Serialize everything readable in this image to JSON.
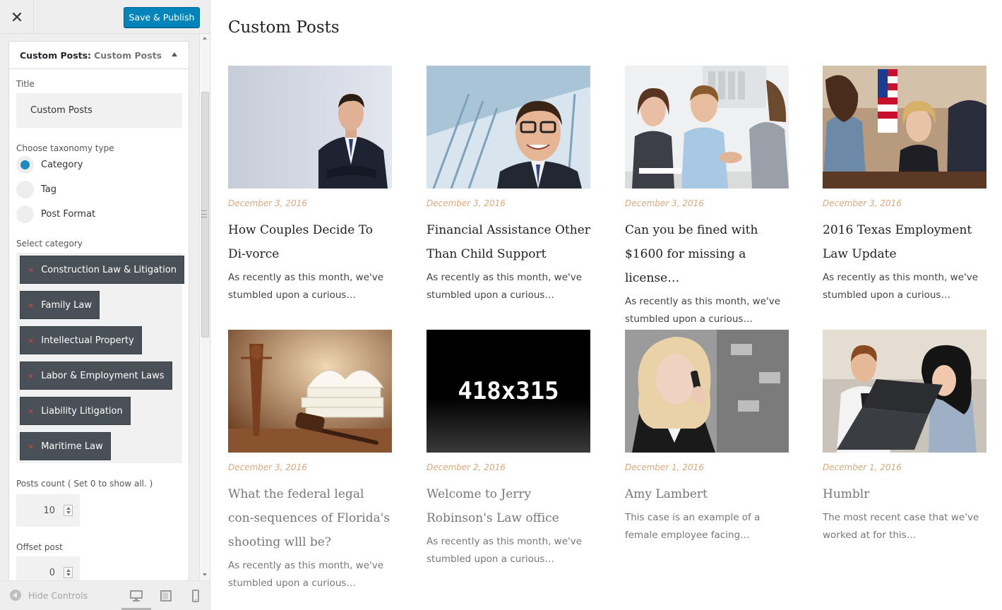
{
  "sidebar": {
    "save_label": "Save & Publish",
    "section_label": "Custom Posts:",
    "section_sub": "Custom Posts",
    "title_label": "Title",
    "title_value": "Custom Posts",
    "taxonomy_label": "Choose taxonomy type",
    "taxonomy_options": [
      "Category",
      "Tag",
      "Post Format"
    ],
    "taxonomy_selected": "Category",
    "category_label": "Select category",
    "categories": [
      "Construction Law & Litigation",
      "Family Law",
      "Intellectual Property",
      "Labor & Employment Laws",
      "Liability Litigation",
      "Maritime Law"
    ],
    "remove_glyph": "×",
    "posts_count_label": "Posts count ( Set 0 to show all. )",
    "posts_count_value": "10",
    "offset_label": "Offset post",
    "offset_value": "0",
    "hide_controls_label": "Hide Controls"
  },
  "preview": {
    "title": "Custom Posts",
    "posts": [
      {
        "date": "December 3, 2016",
        "title": "How Couples Decide To Di-vorce",
        "excerpt": "As recently as this month, we've stumbled upon a curious…"
      },
      {
        "date": "December 3, 2016",
        "title": "Financial Assistance Other Than Child Support",
        "excerpt": "As recently as this month, we've stumbled upon a curious…"
      },
      {
        "date": "December 3, 2016",
        "title": "Can you be fined with $1600 for missing a license…",
        "excerpt": "As recently as this month, we've stumbled upon a curious…"
      },
      {
        "date": "December 3, 2016",
        "title": "2016 Texas Employment Law Update",
        "excerpt": "As recently as this month, we've stumbled upon a curious…"
      },
      {
        "date": "December 3, 2016",
        "title": "What the federal legal con-sequences of Florida's shooting wlll be?",
        "excerpt": "As recently as this month, we've stumbled upon a curious…"
      },
      {
        "date": "December 2, 2016",
        "title": "Welcome to Jerry Robinson's Law office",
        "excerpt": "As recently as this month, we've stumbled upon a curious…",
        "thumb_text": "418x315"
      },
      {
        "date": "December 1, 2016",
        "title": "Amy Lambert",
        "excerpt": "This case is an example of a female employee facing…"
      },
      {
        "date": "December 1, 2016",
        "title": "Humblr",
        "excerpt": "The most recent case that we've worked at for this…"
      }
    ]
  },
  "colors": {
    "primary_button": "#0085ba",
    "radio_selected": "#1e8cbe",
    "chip_bg": "#4a5058",
    "chip_remove": "#e0443b",
    "post_date": "#d9a87c"
  }
}
